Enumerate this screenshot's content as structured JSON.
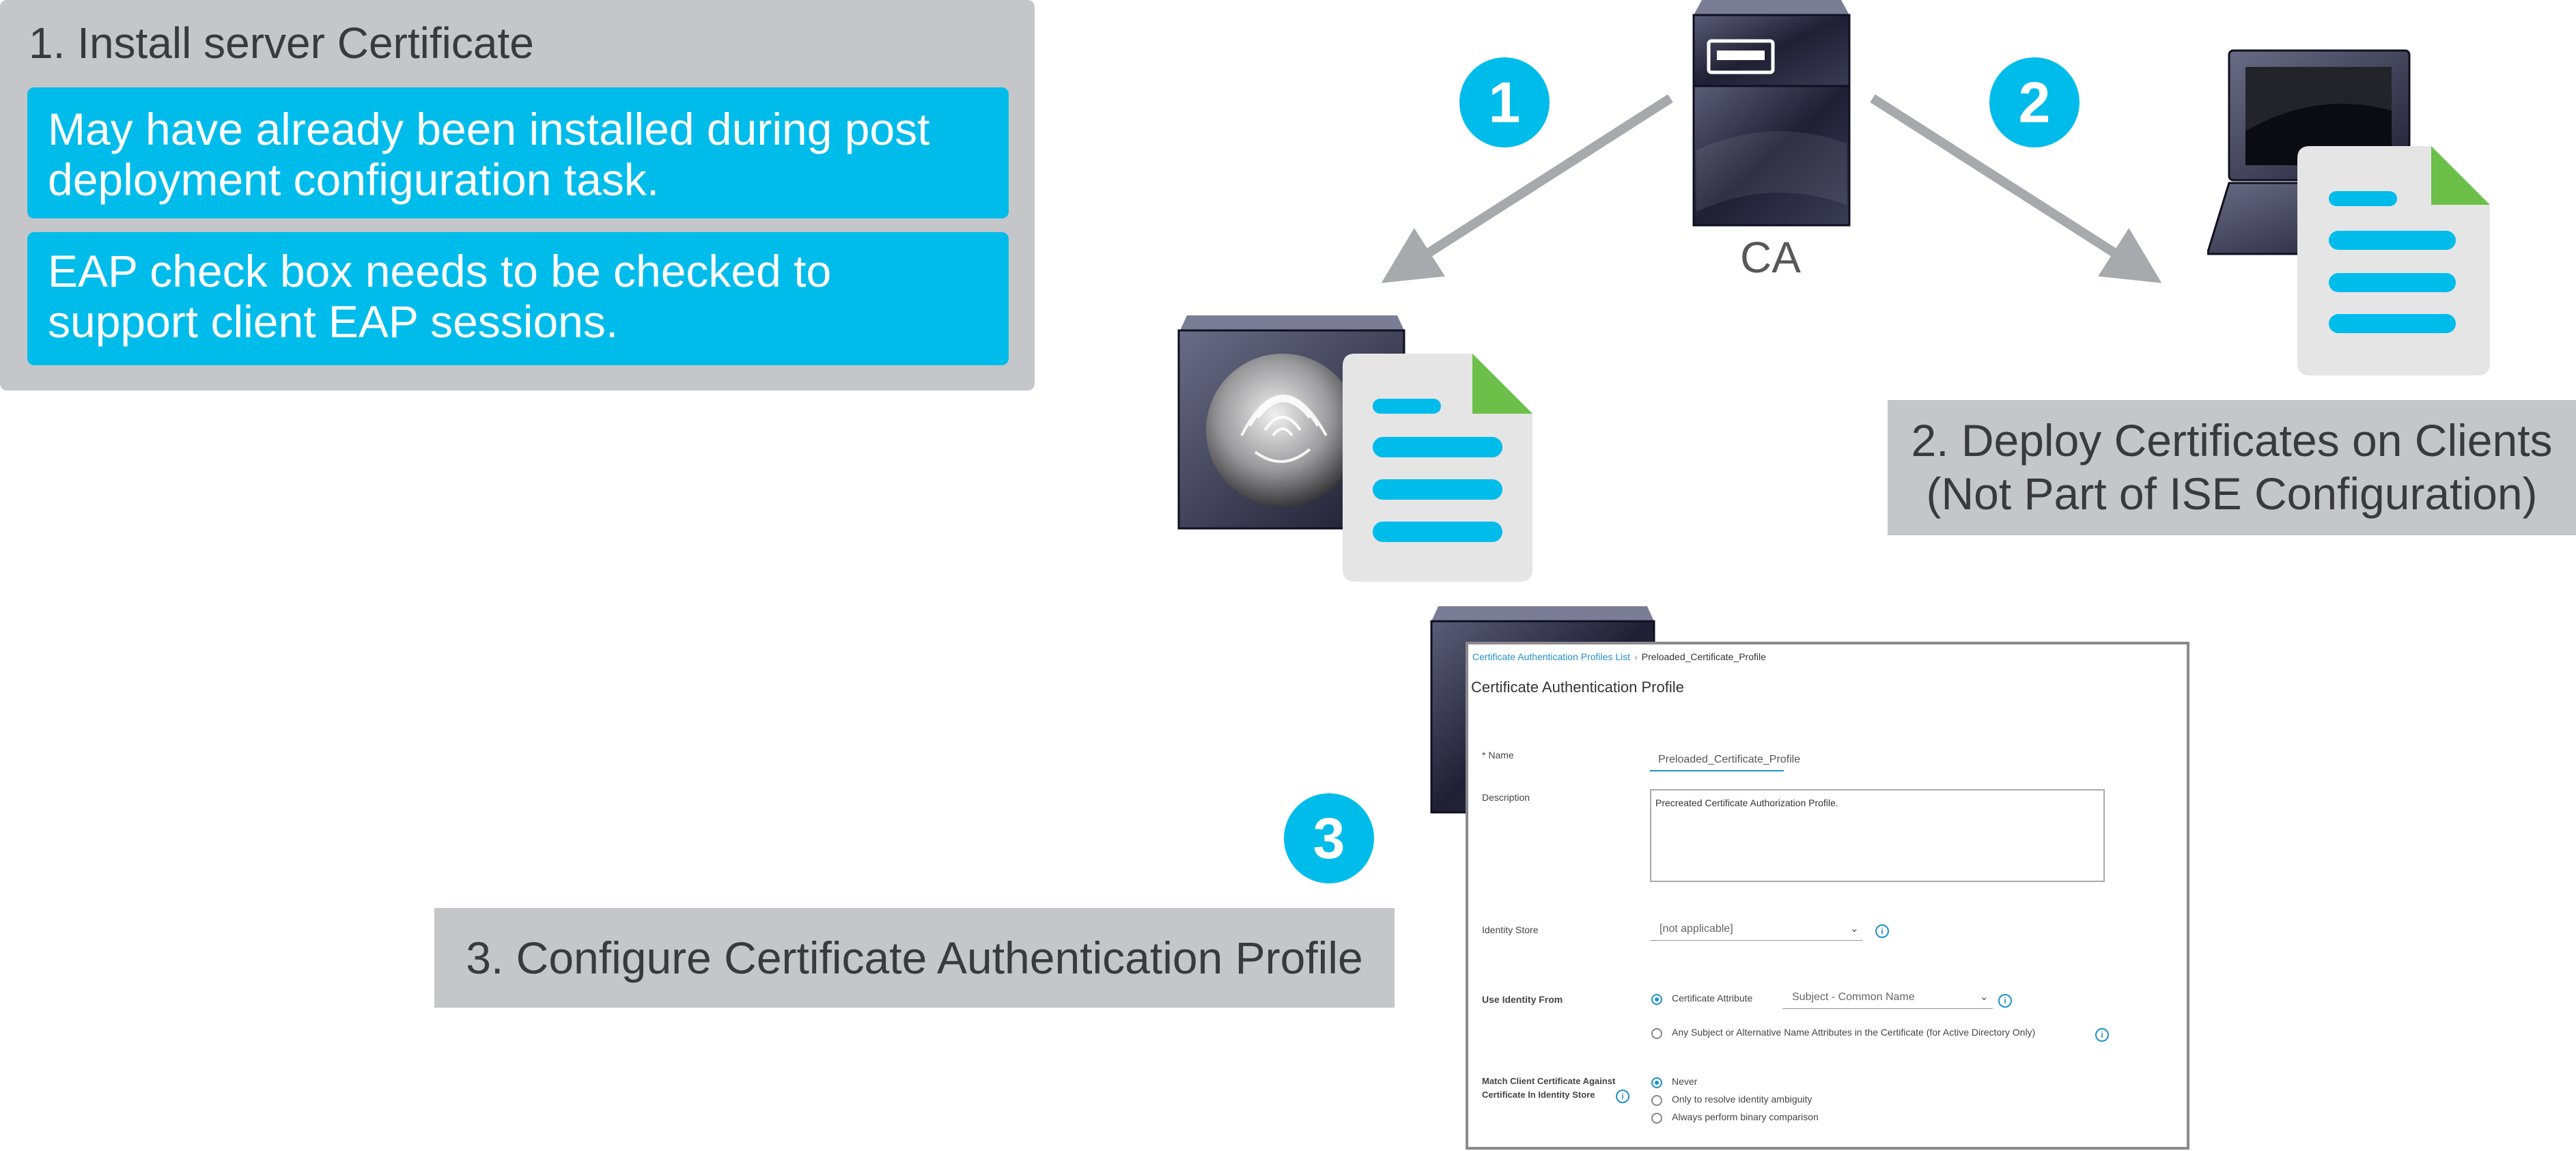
{
  "step1": {
    "title": "1. Install server Certificate",
    "note1_line1": "May have already been installed during post",
    "note1_line2": "deployment configuration task.",
    "note2_line1": "EAP check box needs to be checked to",
    "note2_line2": "support client EAP sessions."
  },
  "markers": {
    "n1": "1",
    "n2": "2",
    "n3": "3"
  },
  "ca_label": "CA",
  "step2": {
    "line1": "2. Deploy Certificates on Clients",
    "line2": "(Not Part of ISE Configuration)"
  },
  "step3": {
    "label": "3. Configure Certificate Authentication Profile"
  },
  "icons": {
    "ca": "server-icon",
    "ise": "ise-appliance-icon",
    "client": "laptop-icon",
    "cert": "certificate-document-icon",
    "arrow": "arrow-icon"
  },
  "colors": {
    "accent": "#00bceb",
    "panel": "#c5c6c9",
    "cert_corner": "#6cc04a",
    "arrow": "#a7a9ac"
  },
  "ui": {
    "breadcrumb_link": "Certificate Authentication Profiles List",
    "breadcrumb_current": "Preloaded_Certificate_Profile",
    "title": "Certificate Authentication Profile",
    "name_label": "* Name",
    "name_value": "Preloaded_Certificate_Profile",
    "description_label": "Description",
    "description_value": "Precreated Certificate Authorization Profile.",
    "identity_store_label": "Identity Store",
    "identity_store_value": "[not applicable]",
    "use_identity_label": "Use Identity From",
    "cert_attribute_option": "Certificate Attribute",
    "cert_attribute_value": "Subject - Common Name",
    "any_subject_option": "Any Subject or Alternative Name Attributes in the Certificate (for Active Directory Only)",
    "match_label_line1": "Match Client Certificate Against",
    "match_label_line2": "Certificate In Identity Store",
    "match_never": "Never",
    "match_ambiguity": "Only to resolve identity ambiguity",
    "match_binary": "Always perform binary comparison"
  }
}
